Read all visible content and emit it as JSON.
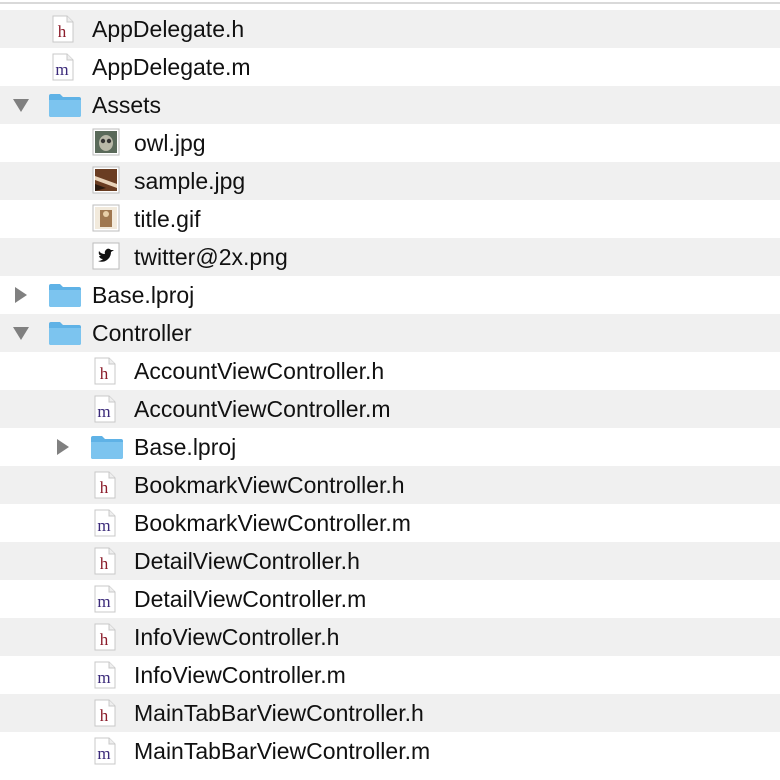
{
  "tree": [
    {
      "name": "AppDelegate.h",
      "kind": "h",
      "level": 0,
      "disclosure": "none"
    },
    {
      "name": "AppDelegate.m",
      "kind": "m",
      "level": 0,
      "disclosure": "none"
    },
    {
      "name": "Assets",
      "kind": "folder",
      "level": 0,
      "disclosure": "expanded"
    },
    {
      "name": "owl.jpg",
      "kind": "image-owl",
      "level": 1,
      "disclosure": "none"
    },
    {
      "name": "sample.jpg",
      "kind": "image-sample",
      "level": 1,
      "disclosure": "none"
    },
    {
      "name": "title.gif",
      "kind": "image-title",
      "level": 1,
      "disclosure": "none"
    },
    {
      "name": "twitter@2x.png",
      "kind": "image-twitter",
      "level": 1,
      "disclosure": "none"
    },
    {
      "name": "Base.lproj",
      "kind": "folder",
      "level": 0,
      "disclosure": "collapsed"
    },
    {
      "name": "Controller",
      "kind": "folder",
      "level": 0,
      "disclosure": "expanded"
    },
    {
      "name": "AccountViewController.h",
      "kind": "h",
      "level": 1,
      "disclosure": "none"
    },
    {
      "name": "AccountViewController.m",
      "kind": "m",
      "level": 1,
      "disclosure": "none"
    },
    {
      "name": "Base.lproj",
      "kind": "folder",
      "level": 1,
      "disclosure": "collapsed"
    },
    {
      "name": "BookmarkViewController.h",
      "kind": "h",
      "level": 1,
      "disclosure": "none"
    },
    {
      "name": "BookmarkViewController.m",
      "kind": "m",
      "level": 1,
      "disclosure": "none"
    },
    {
      "name": "DetailViewController.h",
      "kind": "h",
      "level": 1,
      "disclosure": "none"
    },
    {
      "name": "DetailViewController.m",
      "kind": "m",
      "level": 1,
      "disclosure": "none"
    },
    {
      "name": "InfoViewController.h",
      "kind": "h",
      "level": 1,
      "disclosure": "none"
    },
    {
      "name": "InfoViewController.m",
      "kind": "m",
      "level": 1,
      "disclosure": "none"
    },
    {
      "name": "MainTabBarViewController.h",
      "kind": "h",
      "level": 1,
      "disclosure": "none"
    },
    {
      "name": "MainTabBarViewController.m",
      "kind": "m",
      "level": 1,
      "disclosure": "none"
    }
  ],
  "colors": {
    "h_letter": "#8b1c2a",
    "m_letter": "#3b2a7a",
    "folder": "#7cc4ef",
    "disclosure": "#808080"
  },
  "icons": {
    "h": "h-header-file-icon",
    "m": "m-source-file-icon",
    "folder": "folder-icon",
    "image-owl": "owl-image-icon",
    "image-sample": "sample-image-icon",
    "image-title": "title-image-icon",
    "image-twitter": "twitter-bird-icon"
  }
}
